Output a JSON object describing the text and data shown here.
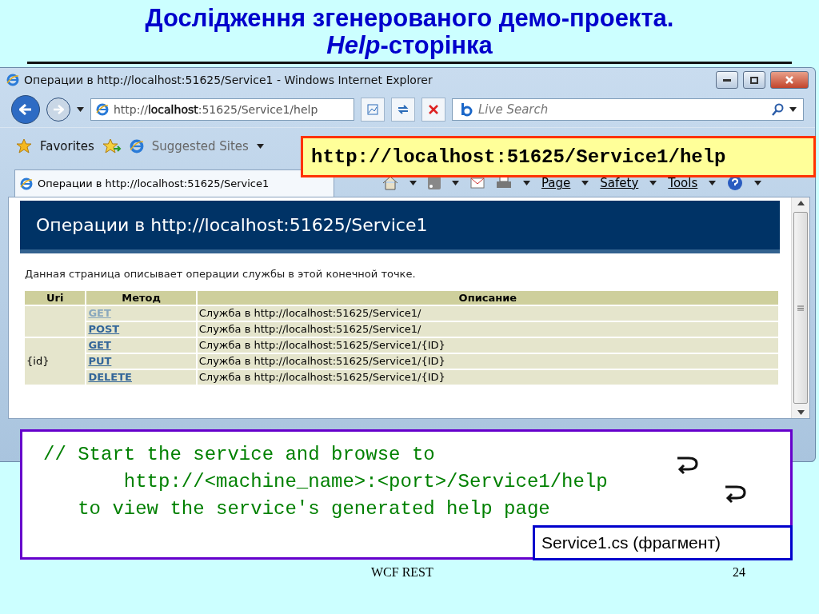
{
  "slide": {
    "title": "Дослідження згенерованого демо-проекта.",
    "subtitle_em": "Help",
    "subtitle_rest": "-сторінка",
    "footer": "WCF REST",
    "page_number": "24"
  },
  "window": {
    "title": "Операции в http://localhost:51625/Service1 - Windows Internet Explorer"
  },
  "address_bar": {
    "prefix": "http://",
    "host": "localhost",
    "rest": ":51625/Service1/help"
  },
  "search": {
    "placeholder": "Live Search"
  },
  "favorites_bar": {
    "favorites": "Favorites",
    "suggested": "Suggested Sites"
  },
  "tab": {
    "label": "Операции в http://localhost:51625/Service1",
    "selected": true
  },
  "command_bar": [
    "Page",
    "Safety",
    "Tools"
  ],
  "url_callout": "http://localhost:51625/Service1/help",
  "page": {
    "heading": "Операции в http://localhost:51625/Service1",
    "intro": "Данная страница описывает операции службы в этой конечной точке.",
    "table": {
      "columns": [
        "Uri",
        "Метод",
        "Описание"
      ],
      "groups": [
        {
          "operations": [
            {
              "method": "GET",
              "visited": true,
              "description": "Служба в http://localhost:51625/Service1/"
            },
            {
              "method": "POST",
              "visited": false,
              "description": "Служба в http://localhost:51625/Service1/"
            }
          ]
        },
        {
          "uri": "{id}",
          "operations": [
            {
              "method": "GET",
              "visited": false,
              "description": "Служба в http://localhost:51625/Service1/{ID}"
            },
            {
              "method": "PUT",
              "visited": false,
              "description": "Служба в http://localhost:51625/Service1/{ID}"
            },
            {
              "method": "DELETE",
              "visited": false,
              "description": "Служба в http://localhost:51625/Service1/{ID}"
            }
          ]
        }
      ]
    }
  },
  "code": {
    "lines": [
      "// Start the service and browse to",
      "       http://<machine_name>:<port>/Service1/help",
      "   to view the service's generated help page"
    ],
    "caption": "Service1.cs (фрагмент)"
  }
}
